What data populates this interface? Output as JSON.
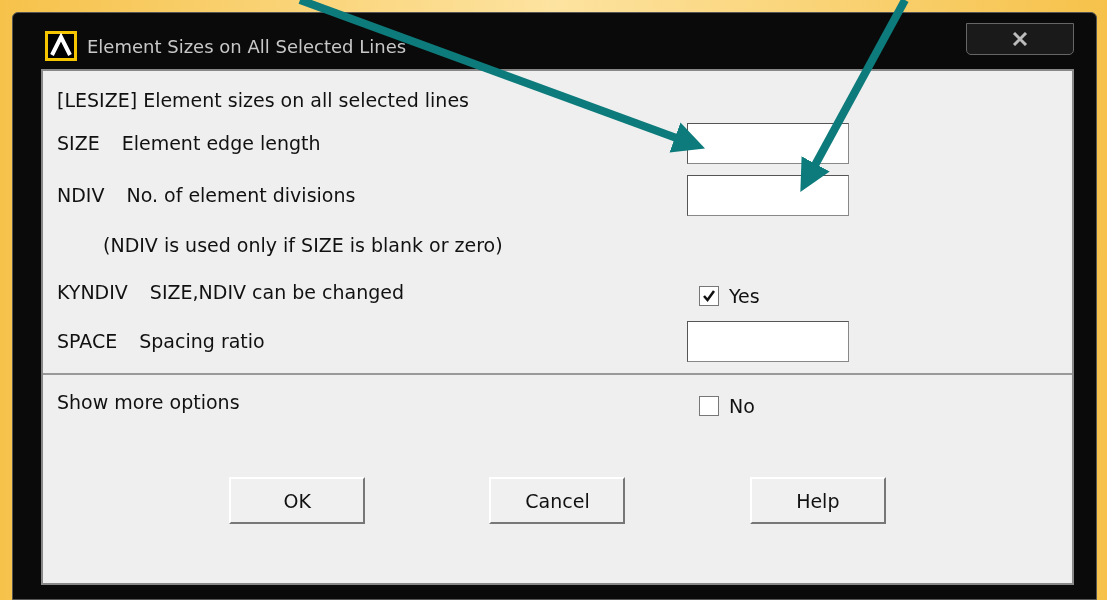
{
  "window": {
    "title": "Element Sizes on All Selected Lines"
  },
  "header": "[LESIZE]  Element sizes on all selected lines",
  "rows": [
    {
      "kind": "field",
      "code": "SIZE",
      "label": "Element edge length"
    },
    {
      "kind": "field",
      "code": "NDIV",
      "label": "No. of element divisions"
    },
    {
      "kind": "note",
      "label": "(NDIV is used only if SIZE is blank or zero)"
    },
    {
      "kind": "checkbox",
      "code": "KYNDIV",
      "label": "SIZE,NDIV can be changed",
      "checked": true,
      "value": "Yes"
    },
    {
      "kind": "field",
      "code": "SPACE",
      "label": "Spacing ratio"
    }
  ],
  "more": {
    "label": "Show more options",
    "checked": false,
    "value": "No"
  },
  "buttons": [
    "OK",
    "Cancel",
    "Help"
  ]
}
